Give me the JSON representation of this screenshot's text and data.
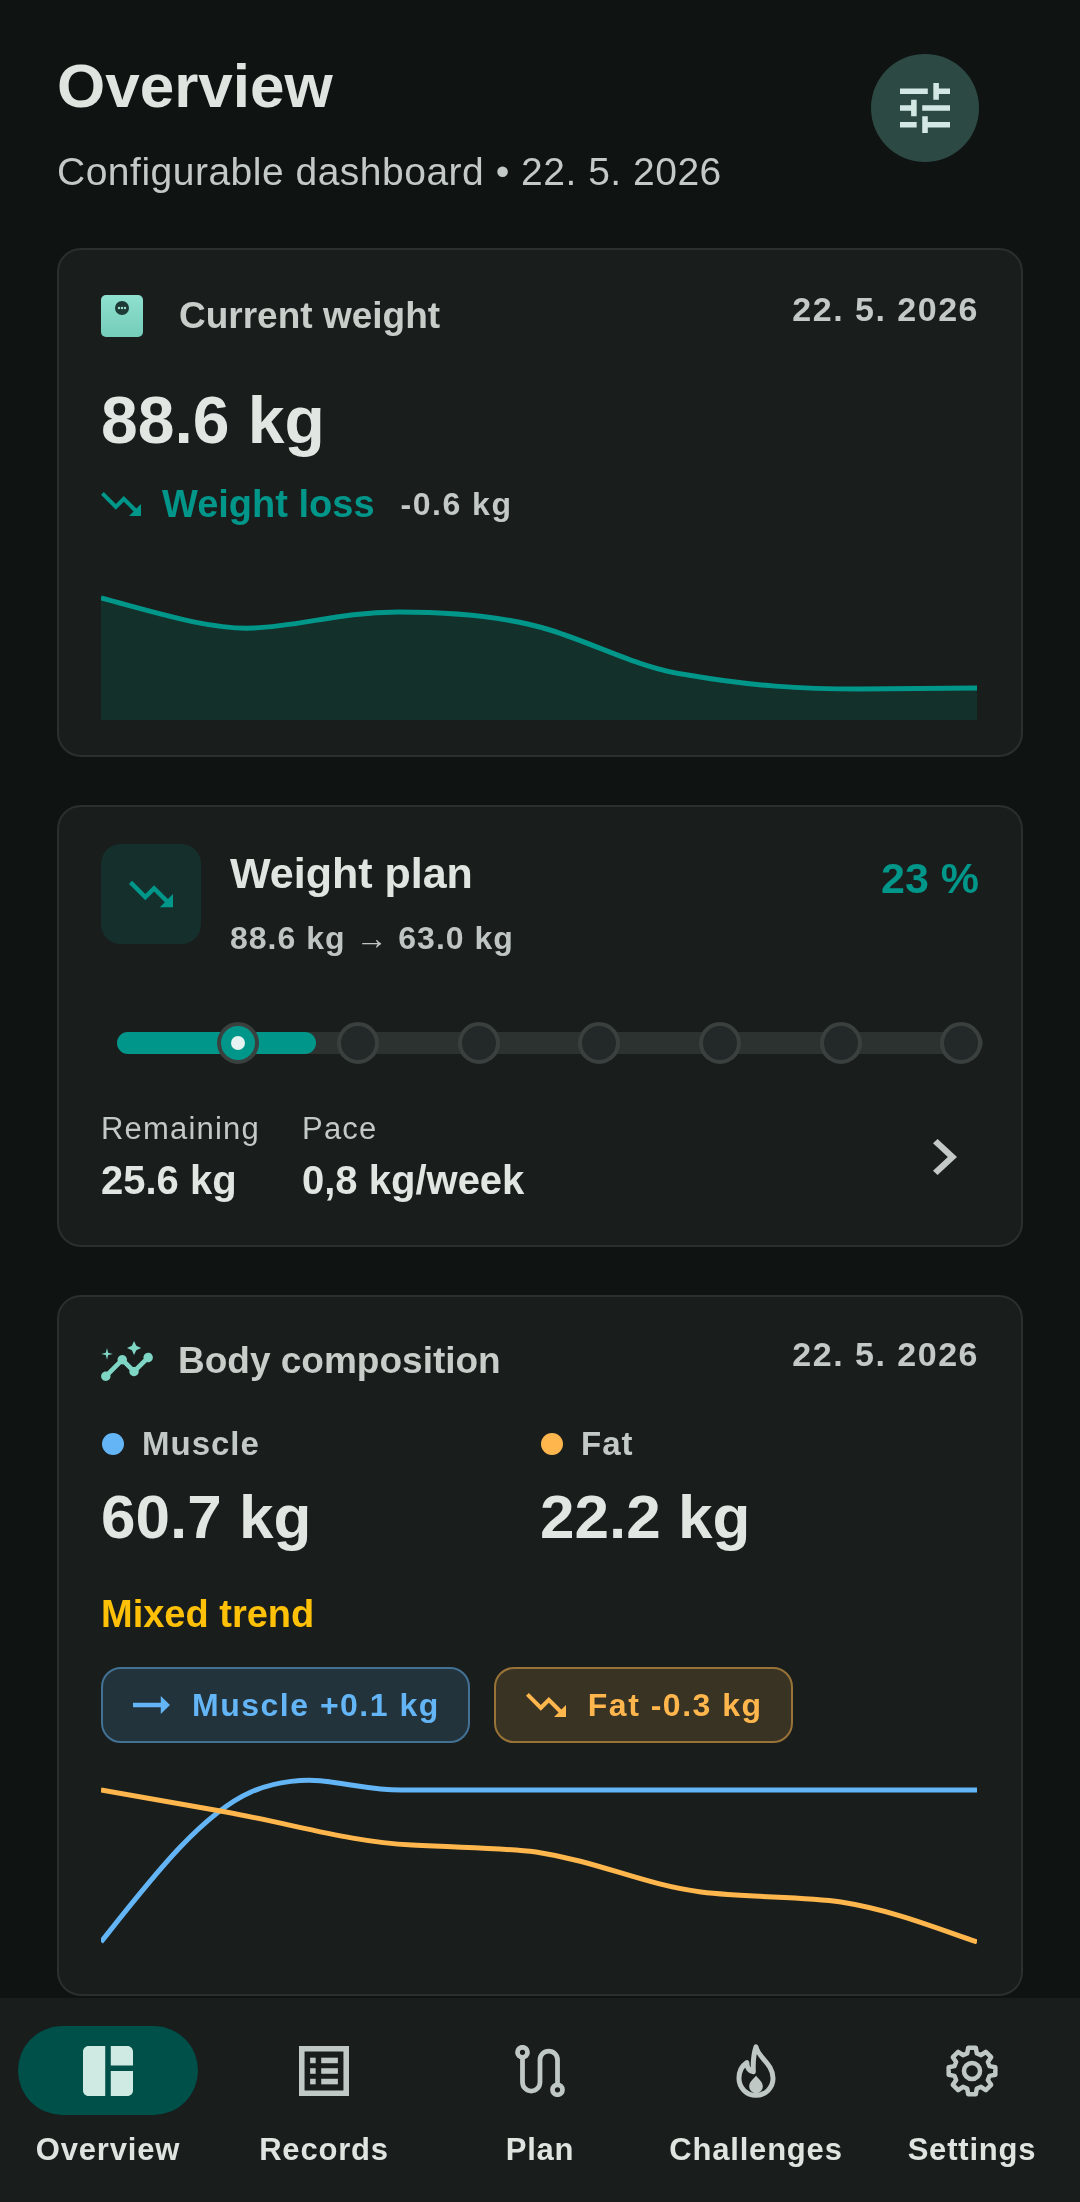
{
  "header": {
    "title": "Overview",
    "subtitle": "Configurable dashboard • 22. 5. 2026"
  },
  "current_weight": {
    "title": "Current weight",
    "date": "22. 5. 2026",
    "value": "88.6 kg",
    "trend": {
      "kind": "down",
      "label": "Weight loss",
      "delta": "-0.6 kg"
    }
  },
  "weight_plan": {
    "title": "Weight plan",
    "route": "88.6 kg → 63.0 kg",
    "percent": "23 %",
    "level": 0.23,
    "milestones": [
      {
        "current": true
      },
      {
        "current": false
      },
      {
        "current": false
      },
      {
        "current": false
      },
      {
        "current": false
      },
      {
        "current": false
      },
      {
        "current": false
      }
    ],
    "stats": [
      {
        "label": "Remaining",
        "value": "25.6 kg"
      },
      {
        "label": "Pace",
        "value": "0,8 kg/week"
      }
    ]
  },
  "body_composition": {
    "title": "Body composition",
    "date": "22. 5. 2026",
    "metrics": [
      {
        "label": "Muscle",
        "value": "60.7 kg",
        "color": "#64b5f6"
      },
      {
        "label": "Fat",
        "value": "22.2 kg",
        "color": "#ffb74d"
      }
    ],
    "trend_label": "Mixed trend",
    "changes": [
      {
        "kind": "flat",
        "label": "Muscle +0.1 kg",
        "color": "#64b5f6"
      },
      {
        "kind": "down",
        "label": "Fat -0.3 kg",
        "color": "#ffb74d"
      }
    ]
  },
  "bottom_nav": [
    {
      "label": "Overview",
      "selected": true
    },
    {
      "label": "Records",
      "selected": false
    },
    {
      "label": "Plan",
      "selected": false
    },
    {
      "label": "Challenges",
      "selected": false
    },
    {
      "label": "Settings",
      "selected": false
    }
  ]
}
